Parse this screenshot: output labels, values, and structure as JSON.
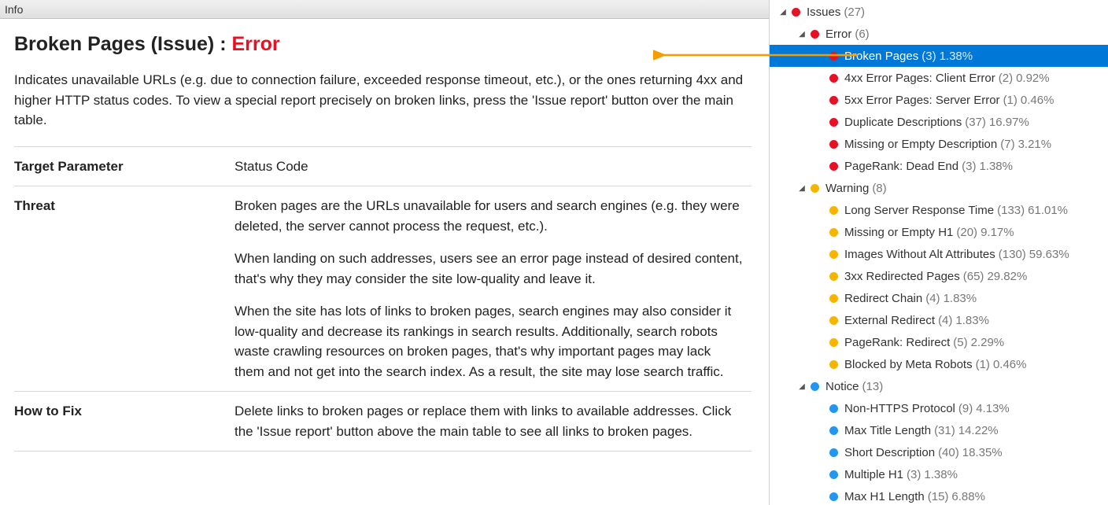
{
  "info_header": "Info",
  "title_prefix": "Broken Pages (Issue) :",
  "title_severity": "Error",
  "description": "Indicates unavailable URLs (e.g. due to connection failure, exceeded response timeout, etc.), or the ones returning 4xx and higher HTTP status codes. To view a special report precisely on broken links, press the 'Issue report' button over the main table.",
  "rows": [
    {
      "label": "Target Parameter",
      "value": [
        "Status Code"
      ]
    },
    {
      "label": "Threat",
      "value": [
        "Broken pages are the URLs unavailable for users and search engines (e.g. they were deleted, the server cannot process the request, etc.).",
        "When landing on such addresses, users see an error page instead of desired content, that's why they may consider the site low-quality and leave it.",
        "When the site has lots of links to broken pages, search engines may also consider it low-quality and decrease its rankings in search results. Additionally, search robots waste crawling resources on broken pages, that's why important pages may lack them and not get into the search index. As a result, the site may lose search traffic."
      ]
    },
    {
      "label": "How to Fix",
      "value": [
        "Delete links to broken pages or replace them with links to available addresses. Click the 'Issue report' button above the main table to see all links to broken pages."
      ]
    }
  ],
  "tree": [
    {
      "indent": 0,
      "expander": true,
      "dot": "error",
      "label": "Issues",
      "count": "(27)",
      "pct": ""
    },
    {
      "indent": 1,
      "expander": true,
      "dot": "error",
      "label": "Error",
      "count": "(6)",
      "pct": ""
    },
    {
      "indent": 2,
      "expander": false,
      "dot": "error",
      "label": "Broken Pages",
      "count": "(3)",
      "pct": "1.38%",
      "selected": true
    },
    {
      "indent": 2,
      "expander": false,
      "dot": "error",
      "label": "4xx Error Pages: Client Error",
      "count": "(2)",
      "pct": "0.92%"
    },
    {
      "indent": 2,
      "expander": false,
      "dot": "error",
      "label": "5xx Error Pages: Server Error",
      "count": "(1)",
      "pct": "0.46%"
    },
    {
      "indent": 2,
      "expander": false,
      "dot": "error",
      "label": "Duplicate Descriptions",
      "count": "(37)",
      "pct": "16.97%"
    },
    {
      "indent": 2,
      "expander": false,
      "dot": "error",
      "label": "Missing or Empty Description",
      "count": "(7)",
      "pct": "3.21%"
    },
    {
      "indent": 2,
      "expander": false,
      "dot": "error",
      "label": "PageRank: Dead End",
      "count": "(3)",
      "pct": "1.38%"
    },
    {
      "indent": 1,
      "expander": true,
      "dot": "warning",
      "label": "Warning",
      "count": "(8)",
      "pct": ""
    },
    {
      "indent": 2,
      "expander": false,
      "dot": "warning",
      "label": "Long Server Response Time",
      "count": "(133)",
      "pct": "61.01%"
    },
    {
      "indent": 2,
      "expander": false,
      "dot": "warning",
      "label": "Missing or Empty H1",
      "count": "(20)",
      "pct": "9.17%"
    },
    {
      "indent": 2,
      "expander": false,
      "dot": "warning",
      "label": "Images Without Alt Attributes",
      "count": "(130)",
      "pct": "59.63%"
    },
    {
      "indent": 2,
      "expander": false,
      "dot": "warning",
      "label": "3xx Redirected Pages",
      "count": "(65)",
      "pct": "29.82%"
    },
    {
      "indent": 2,
      "expander": false,
      "dot": "warning",
      "label": "Redirect Chain",
      "count": "(4)",
      "pct": "1.83%"
    },
    {
      "indent": 2,
      "expander": false,
      "dot": "warning",
      "label": "External Redirect",
      "count": "(4)",
      "pct": "1.83%"
    },
    {
      "indent": 2,
      "expander": false,
      "dot": "warning",
      "label": "PageRank: Redirect",
      "count": "(5)",
      "pct": "2.29%"
    },
    {
      "indent": 2,
      "expander": false,
      "dot": "warning",
      "label": "Blocked by Meta Robots",
      "count": "(1)",
      "pct": "0.46%"
    },
    {
      "indent": 1,
      "expander": true,
      "dot": "notice",
      "label": "Notice",
      "count": "(13)",
      "pct": ""
    },
    {
      "indent": 2,
      "expander": false,
      "dot": "notice",
      "label": "Non-HTTPS Protocol",
      "count": "(9)",
      "pct": "4.13%"
    },
    {
      "indent": 2,
      "expander": false,
      "dot": "notice",
      "label": "Max Title Length",
      "count": "(31)",
      "pct": "14.22%"
    },
    {
      "indent": 2,
      "expander": false,
      "dot": "notice",
      "label": "Short Description",
      "count": "(40)",
      "pct": "18.35%"
    },
    {
      "indent": 2,
      "expander": false,
      "dot": "notice",
      "label": "Multiple H1",
      "count": "(3)",
      "pct": "1.38%"
    },
    {
      "indent": 2,
      "expander": false,
      "dot": "notice",
      "label": "Max H1 Length",
      "count": "(15)",
      "pct": "6.88%"
    }
  ],
  "colors": {
    "error": "#e81123",
    "warning": "#f7b500",
    "notice": "#2196f3",
    "selection": "#0078d7",
    "arrow": "#f59c00"
  }
}
